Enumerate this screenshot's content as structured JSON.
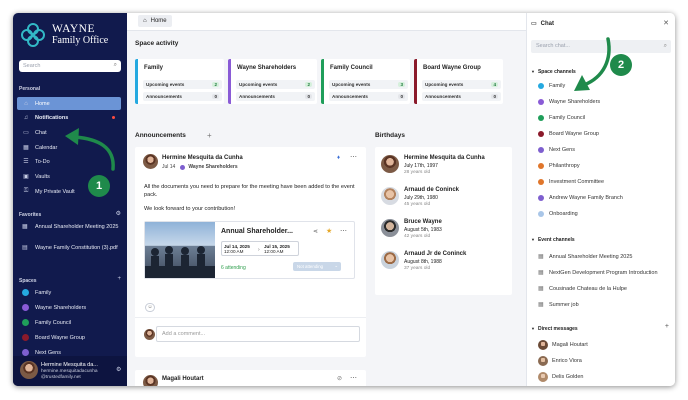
{
  "brand": {
    "line1": "WAYNE",
    "line2": "Family Office"
  },
  "sidebar": {
    "search_placeholder": "Search",
    "personal_title": "Personal",
    "nav": [
      {
        "label": "Home"
      },
      {
        "label": "Notifications"
      },
      {
        "label": "Chat"
      },
      {
        "label": "Calendar"
      },
      {
        "label": "To-Do"
      },
      {
        "label": "Vaults"
      },
      {
        "label": "My Private Vault"
      }
    ],
    "favorites_title": "Favorites",
    "favorites": [
      {
        "label": "Annual Shareholder Meeting 2025"
      },
      {
        "label": "Wayne Family Constitution (3).pdf"
      }
    ],
    "spaces_title": "Spaces",
    "spaces": [
      {
        "label": "Family",
        "color": "#25a9e0"
      },
      {
        "label": "Wayne Shareholders",
        "color": "#8a5bd6"
      },
      {
        "label": "Family Council",
        "color": "#1f9e5a"
      },
      {
        "label": "Board Wayne Group",
        "color": "#8b1a2b"
      },
      {
        "label": "Next Gens",
        "color": "#7e5fcf"
      }
    ],
    "user": {
      "name": "Hermine Mesquita da...",
      "email": "hermine.mesquitadacunha @trustedfamily.net"
    }
  },
  "topbar": {
    "tab": "Home"
  },
  "space_activity": {
    "title": "Space activity",
    "cards": [
      {
        "name": "Family",
        "color": "#25a9e0",
        "events_label": "Upcoming events",
        "events": "2",
        "ann_label": "Announcements",
        "ann": "0"
      },
      {
        "name": "Wayne Shareholders",
        "color": "#8a5bd6",
        "events_label": "Upcoming events",
        "events": "2",
        "ann_label": "Announcements",
        "ann": "0"
      },
      {
        "name": "Family Council",
        "color": "#1f9e5a",
        "events_label": "Upcoming events",
        "events": "3",
        "ann_label": "Announcements",
        "ann": "0"
      },
      {
        "name": "Board Wayne Group",
        "color": "#8b1a2b",
        "events_label": "Upcoming events",
        "events": "4",
        "ann_label": "Announcements",
        "ann": "0"
      }
    ]
  },
  "announcements": {
    "title": "Announcements",
    "add": "+",
    "post": {
      "author": "Hermine Mesquita da Cunha",
      "date": "Jul 14",
      "space": "Wayne Shareholders",
      "body1": "All the documents you need to prepare for the meeting have been added to the event pack.",
      "body2": "We look forward to your contribution!",
      "event": {
        "title": "Annual Shareholder...",
        "start_date": "Jul 14, 2025",
        "start_time": "12:00 AM",
        "end_date": "Jul 15, 2025",
        "end_time": "12:00 AM",
        "attending": "6 attending",
        "rsvp": "Not attending"
      },
      "comment_placeholder": "Add a comment..."
    },
    "post2_author": "Magali Houtart"
  },
  "birthdays": {
    "title": "Birthdays",
    "items": [
      {
        "name": "Hermine Mesquita da Cunha",
        "date": "July 17th, 1997",
        "age": "28 years old"
      },
      {
        "name": "Arnaud de Coninck",
        "date": "July 29th, 1980",
        "age": "45 years old"
      },
      {
        "name": "Bruce Wayne",
        "date": "August 5th, 1983",
        "age": "42 years old"
      },
      {
        "name": "Arnaud Jr de Coninck",
        "date": "August 8th, 1988",
        "age": "37 years old"
      }
    ]
  },
  "chat": {
    "title": "Chat",
    "search_placeholder": "Search chat...",
    "space_channels_title": "Space channels",
    "space_channels": [
      {
        "label": "Family",
        "color": "#25a9e0"
      },
      {
        "label": "Wayne Shareholders",
        "color": "#8a5bd6"
      },
      {
        "label": "Family Council",
        "color": "#1f9e5a"
      },
      {
        "label": "Board Wayne Group",
        "color": "#8b1a2b"
      },
      {
        "label": "Next Gens",
        "color": "#7e5fcf"
      },
      {
        "label": "Philanthropy",
        "color": "#e0762b"
      },
      {
        "label": "Investment Committee",
        "color": "#e0762b"
      },
      {
        "label": "Andrew Wayne Family Branch",
        "color": "#7e5fcf"
      },
      {
        "label": "Onboarding",
        "color": "#a9c6e8"
      }
    ],
    "event_channels_title": "Event channels",
    "event_channels": [
      {
        "label": "Annual Shareholder Meeting 2025"
      },
      {
        "label": "NextGen Development Program Introduction"
      },
      {
        "label": "Cousinade Chateau de la Hulpe"
      },
      {
        "label": "Summer job"
      }
    ],
    "dm_title": "Direct messages",
    "dms": [
      {
        "label": "Magali Houtart"
      },
      {
        "label": "Enrico Viora"
      },
      {
        "label": "Delis Golden"
      }
    ]
  },
  "callouts": {
    "one": "1",
    "two": "2"
  }
}
